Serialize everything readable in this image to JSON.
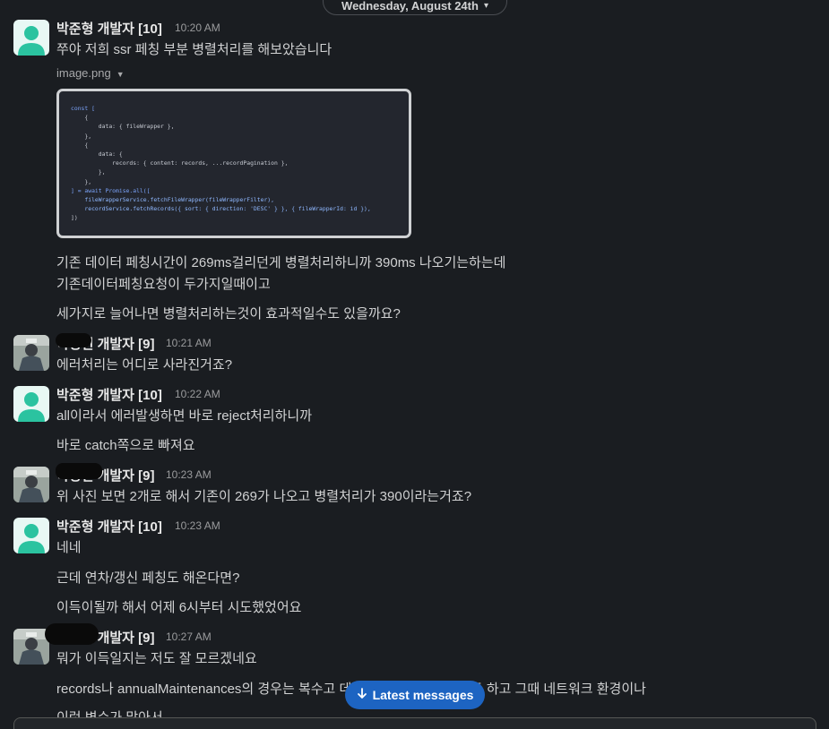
{
  "date_divider": {
    "label": "Wednesday, August 24th"
  },
  "messages": [
    {
      "sender": "박준형 개발자 [10]",
      "time": "10:20 AM",
      "lines": [
        "쭈야 저희 ssr 페칭 부분 병렬처리를 해보았습니다"
      ],
      "attachment": {
        "name": "image.png"
      },
      "after_lines": [
        "기존 데이터 페칭시간이 269ms걸리던게 병렬처리하니까 390ms 나오기는하는데",
        "기존데이터페칭요청이 두가지일때이고",
        "세가지로 늘어나면 병렬처리하는것이 효과적일수도 있을까요?"
      ]
    },
    {
      "sender": "박정현 개발자 [9]",
      "time": "10:21 AM",
      "lines": [
        "에러처리는 어디로 사라진거죠?"
      ]
    },
    {
      "sender": "박준형 개발자 [10]",
      "time": "10:22 AM",
      "lines": [
        "all이라서 에러발생하면 바로 reject처리하니까",
        "바로 catch쪽으로 빠져요"
      ]
    },
    {
      "sender": "박정현 개발자 [9]",
      "time": "10:23 AM",
      "lines": [
        "위 사진 보면 2개로 해서 기존이 269가 나오고 병렬처리가 390이라는거죠?"
      ]
    },
    {
      "sender": "박준형 개발자 [10]",
      "time": "10:23 AM",
      "lines": [
        "네네",
        "근데 연차/갱신 페칭도 해온다면?",
        "이득이될까 해서 어제 6시부터 시도했었어요"
      ]
    },
    {
      "sender": "박정현 개발자 [9]",
      "time": "10:27 AM",
      "lines": [
        "뭐가 이득일지는 저도 잘 모르겠네요",
        "records나 annualMaintenances의 경우는 복수고 데이터 개수가 많아지기도 하고 그때 네트워크 환경이나",
        "이런 변수가 많아서"
      ]
    }
  ],
  "code_image": {
    "lines": [
      "const [",
      "    {",
      "        data: { fileWrapper },",
      "    },",
      "    {",
      "        data: {",
      "            records: { content: records, ...recordPagination },",
      "        },",
      "    },",
      "] = await Promise.all([",
      "    fileWrapperService.fetchFileWrapper(fileWrapperFilter),",
      "    recordService.fetchRecords({ sort: { direction: 'DESC' } }, { fileWrapperId: id }),",
      "])"
    ]
  },
  "latest_button": {
    "label": "Latest messages",
    "icon": "arrow-down-icon"
  },
  "colors": {
    "background": "#1a1d21",
    "button": "#1d64c2",
    "avatar_default": "#2bc3a0"
  }
}
